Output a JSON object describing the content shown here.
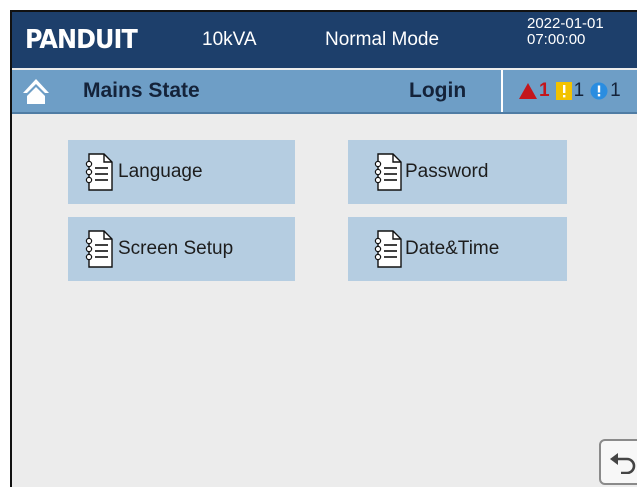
{
  "header": {
    "brand": "PANDUIT",
    "capacity": "10kVA",
    "mode": "Normal Mode",
    "date": "2022-01-01",
    "time": "07:00:00"
  },
  "statusbar": {
    "state": "Mains State",
    "login": "Login",
    "alarms": [
      {
        "icon": "warning-triangle-icon",
        "count": "1",
        "color": "#c4161c"
      },
      {
        "icon": "exclamation-square-icon",
        "count": "1",
        "color": "#f2c200"
      },
      {
        "icon": "info-circle-icon",
        "count": "1",
        "color": "#2a8de0"
      }
    ]
  },
  "menu": [
    {
      "label": "Language",
      "icon": "document-icon"
    },
    {
      "label": "Password",
      "icon": "document-icon"
    },
    {
      "label": "Screen Setup",
      "icon": "document-icon"
    },
    {
      "label": "Date&Time",
      "icon": "document-icon"
    }
  ],
  "colors": {
    "header_bg": "#1d3f6b",
    "statusbar_bg": "#6e9ec6",
    "tile_bg": "#b5cde1",
    "page_bg": "#ececec"
  }
}
